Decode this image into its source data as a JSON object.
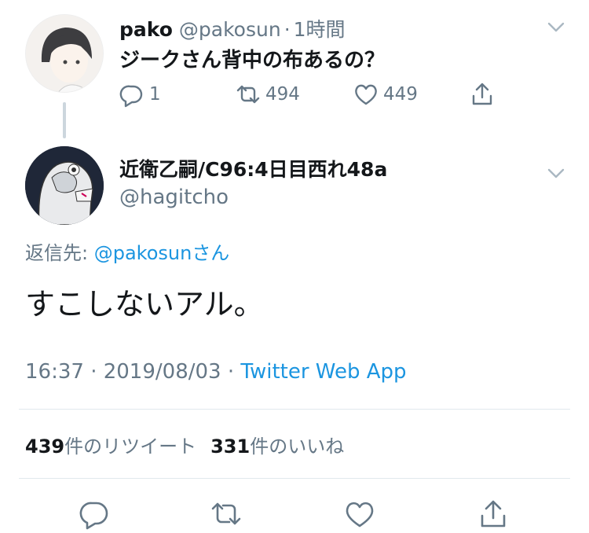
{
  "parent_tweet": {
    "display_name": "pako",
    "handle": "@pakosun",
    "separator": "·",
    "time": "1時間",
    "text": "ジークさん背中の布あるの？",
    "actions": {
      "reply_count": "1",
      "retweet_count": "494",
      "like_count": "449"
    }
  },
  "main_tweet": {
    "display_name": "近衛乙嗣/C96:4日目西れ48a",
    "handle": "@hagitcho",
    "reply_label": "返信先: ",
    "reply_mention": "@pakosunさん",
    "text": "すこしないアル。",
    "timestamp": "16:37 · 2019/08/03 · ",
    "source": "Twitter Web App",
    "stats": {
      "retweets_number": "439",
      "retweets_label": "件のリツイート",
      "likes_number": "331",
      "likes_label": "件のいいね"
    }
  },
  "colors": {
    "text": "#14171a",
    "muted": "#657786",
    "link": "#1b95e0",
    "divider": "#e1e8ed"
  },
  "icons": [
    "chevron-down-icon",
    "reply-icon",
    "retweet-icon",
    "like-icon",
    "share-icon"
  ]
}
